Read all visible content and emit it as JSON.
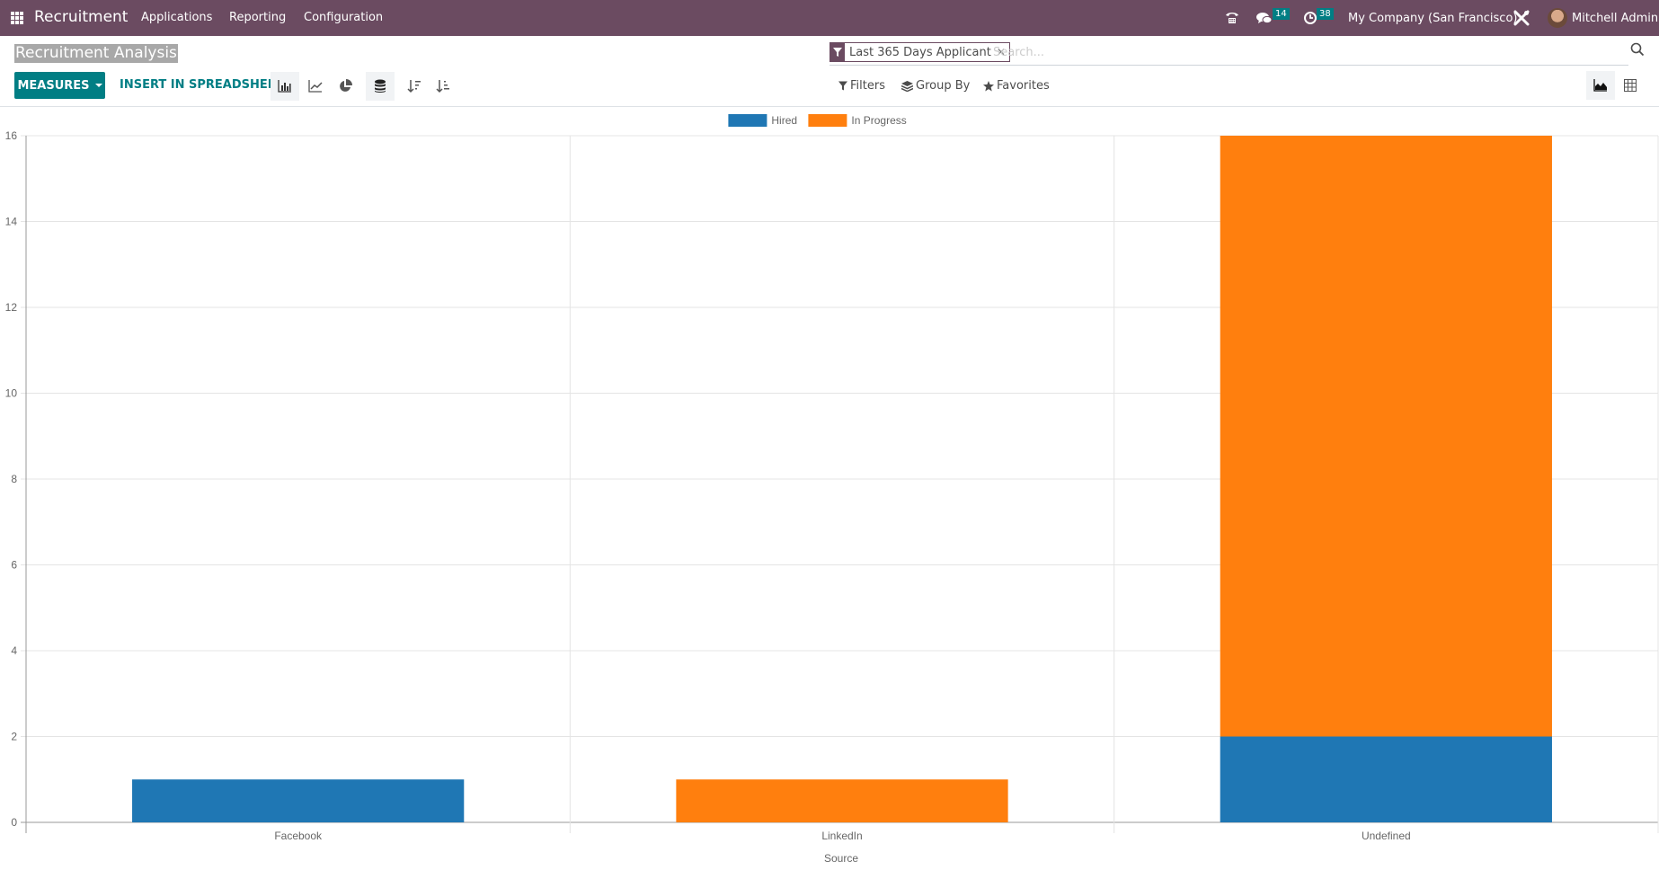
{
  "navbar": {
    "app_name": "Recruitment",
    "menu": [
      "Applications",
      "Reporting",
      "Configuration"
    ],
    "messages_count": "14",
    "activities_count": "38",
    "company": "My Company (San Francisco)",
    "user": "Mitchell Admin",
    "brand_color": "#6b4b61"
  },
  "page": {
    "title": "Recruitment Analysis"
  },
  "search": {
    "facet_label": "Last 365 Days Applicant",
    "placeholder": "Search...",
    "value": ""
  },
  "toolbar": {
    "measures_label": "MEASURES",
    "spreadsheet_label": "INSERT IN SPREADSHEET",
    "filters_label": "Filters",
    "groupby_label": "Group By",
    "favorites_label": "Favorites",
    "accent_color": "#017e84"
  },
  "chart_data": {
    "type": "bar",
    "stacked": true,
    "title": "",
    "xlabel": "Source",
    "ylabel": "",
    "categories": [
      "Facebook",
      "LinkedIn",
      "Undefined"
    ],
    "series": [
      {
        "name": "Hired",
        "color": "#1f77b4",
        "values": [
          1,
          0,
          2
        ]
      },
      {
        "name": "In Progress",
        "color": "#ff7f0e",
        "values": [
          0,
          1,
          14
        ]
      }
    ],
    "ylim": [
      0,
      16
    ],
    "yticks": [
      0,
      2,
      4,
      6,
      8,
      10,
      12,
      14,
      16
    ],
    "grid": true,
    "legend": "top-center"
  }
}
